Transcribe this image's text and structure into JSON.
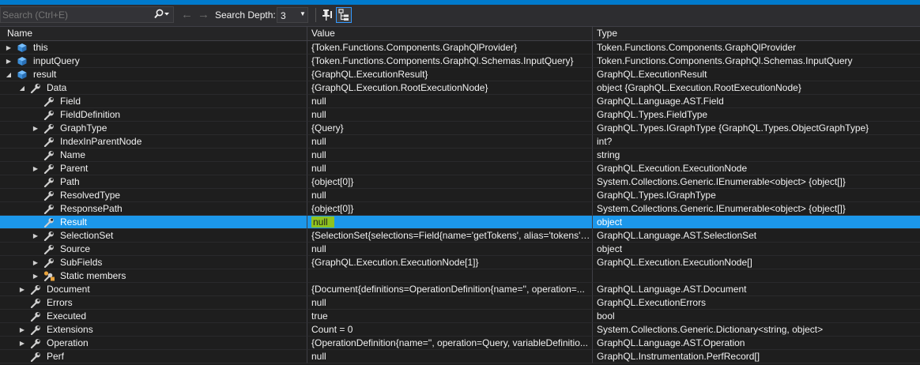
{
  "toolbar": {
    "search_placeholder": "Search (Ctrl+E)",
    "search_depth_label": "Search Depth:",
    "search_depth_value": "3"
  },
  "columns": {
    "name": "Name",
    "value": "Value",
    "type": "Type"
  },
  "rows": [
    {
      "name": "this",
      "value": "{Token.Functions.Components.GraphQlProvider}",
      "type": "Token.Functions.Components.GraphQlProvider",
      "depth": 0,
      "expander": "collapsed",
      "icon": "cube-icon"
    },
    {
      "name": "inputQuery",
      "value": "{Token.Functions.Components.GraphQl.Schemas.InputQuery}",
      "type": "Token.Functions.Components.GraphQl.Schemas.InputQuery",
      "depth": 0,
      "expander": "collapsed",
      "icon": "cube-icon"
    },
    {
      "name": "result",
      "value": "{GraphQL.ExecutionResult}",
      "type": "GraphQL.ExecutionResult",
      "depth": 0,
      "expander": "expanded",
      "icon": "cube-icon"
    },
    {
      "name": "Data",
      "value": "{GraphQL.Execution.RootExecutionNode}",
      "type": "object {GraphQL.Execution.RootExecutionNode}",
      "depth": 1,
      "expander": "expanded",
      "icon": "wrench-icon"
    },
    {
      "name": "Field",
      "value": "null",
      "type": "GraphQL.Language.AST.Field",
      "depth": 2,
      "expander": "none",
      "icon": "wrench-icon"
    },
    {
      "name": "FieldDefinition",
      "value": "null",
      "type": "GraphQL.Types.FieldType",
      "depth": 2,
      "expander": "none",
      "icon": "wrench-icon"
    },
    {
      "name": "GraphType",
      "value": "{Query}",
      "type": "GraphQL.Types.IGraphType {GraphQL.Types.ObjectGraphType}",
      "depth": 2,
      "expander": "collapsed",
      "icon": "wrench-icon"
    },
    {
      "name": "IndexInParentNode",
      "value": "null",
      "type": "int?",
      "depth": 2,
      "expander": "none",
      "icon": "wrench-icon"
    },
    {
      "name": "Name",
      "value": "null",
      "type": "string",
      "depth": 2,
      "expander": "none",
      "icon": "wrench-icon"
    },
    {
      "name": "Parent",
      "value": "null",
      "type": "GraphQL.Execution.ExecutionNode",
      "depth": 2,
      "expander": "collapsed",
      "icon": "wrench-icon"
    },
    {
      "name": "Path",
      "value": "{object[0]}",
      "type": "System.Collections.Generic.IEnumerable<object> {object[]}",
      "depth": 2,
      "expander": "none",
      "icon": "wrench-icon"
    },
    {
      "name": "ResolvedType",
      "value": "null",
      "type": "GraphQL.Types.IGraphType",
      "depth": 2,
      "expander": "none",
      "icon": "wrench-icon"
    },
    {
      "name": "ResponsePath",
      "value": "{object[0]}",
      "type": "System.Collections.Generic.IEnumerable<object> {object[]}",
      "depth": 2,
      "expander": "none",
      "icon": "wrench-icon"
    },
    {
      "name": "Result",
      "value": "null",
      "type": "object",
      "depth": 2,
      "expander": "none",
      "icon": "wrench-icon",
      "selected": true
    },
    {
      "name": "SelectionSet",
      "value": "{SelectionSet{selections=Field{name='getTokens', alias='tokens', ...",
      "type": "GraphQL.Language.AST.SelectionSet",
      "depth": 2,
      "expander": "collapsed",
      "icon": "wrench-icon"
    },
    {
      "name": "Source",
      "value": "null",
      "type": "object",
      "depth": 2,
      "expander": "none",
      "icon": "wrench-icon"
    },
    {
      "name": "SubFields",
      "value": "{GraphQL.Execution.ExecutionNode[1]}",
      "type": "GraphQL.Execution.ExecutionNode[]",
      "depth": 2,
      "expander": "collapsed",
      "icon": "wrench-icon"
    },
    {
      "name": "Static members",
      "value": "",
      "type": "",
      "depth": 2,
      "expander": "collapsed",
      "icon": "static-members-icon"
    },
    {
      "name": "Document",
      "value": "{Document{definitions=OperationDefinition{name='', operation=...",
      "type": "GraphQL.Language.AST.Document",
      "depth": 1,
      "expander": "collapsed",
      "icon": "wrench-icon"
    },
    {
      "name": "Errors",
      "value": "null",
      "type": "GraphQL.ExecutionErrors",
      "depth": 1,
      "expander": "none",
      "icon": "wrench-icon"
    },
    {
      "name": "Executed",
      "value": "true",
      "type": "bool",
      "depth": 1,
      "expander": "none",
      "icon": "wrench-icon"
    },
    {
      "name": "Extensions",
      "value": "Count = 0",
      "type": "System.Collections.Generic.Dictionary<string, object>",
      "depth": 1,
      "expander": "collapsed",
      "icon": "wrench-icon"
    },
    {
      "name": "Operation",
      "value": "{OperationDefinition{name='', operation=Query, variableDefinitio...",
      "type": "GraphQL.Language.AST.Operation",
      "depth": 1,
      "expander": "collapsed",
      "icon": "wrench-icon"
    },
    {
      "name": "Perf",
      "value": "null",
      "type": "GraphQL.Instrumentation.PerfRecord[]",
      "depth": 1,
      "expander": "none",
      "icon": "wrench-icon"
    }
  ]
}
